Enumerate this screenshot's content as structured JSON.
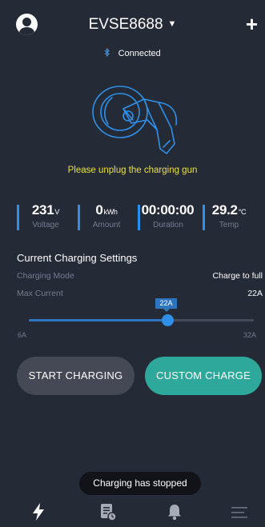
{
  "header": {
    "device_name": "EVSE8688",
    "caret": "▼",
    "add_label": "+"
  },
  "connection": {
    "icon": "bluetooth-icon",
    "status": "Connected"
  },
  "charger": {
    "image_icon": "charging-gun-icon",
    "notice": "Please unplug the charging gun"
  },
  "stats": [
    {
      "value": "231",
      "unit": "V",
      "label": "Voltage"
    },
    {
      "value": "0",
      "unit": "kWh",
      "label": "Amount"
    },
    {
      "value": "00:00:00",
      "unit": "",
      "label": "Duration"
    },
    {
      "value": "29.2",
      "unit": "°C",
      "label": "Temp"
    }
  ],
  "settings": {
    "title": "Current Charging Settings",
    "mode_label": "Charging Mode",
    "mode_value": "Charge to full",
    "max_current_label": "Max Current",
    "max_current_value": "22A",
    "slider": {
      "value_label": "22A",
      "min_label": "6A",
      "max_label": "32A",
      "min": 6,
      "max": 32,
      "value": 22
    }
  },
  "buttons": {
    "start": "START CHARGING",
    "custom": "CUSTOM CHARGE"
  },
  "toast": "Charging has stopped",
  "nav": [
    {
      "icon": "lightning-icon",
      "active": true
    },
    {
      "icon": "records-icon",
      "active": false
    },
    {
      "icon": "bell-icon",
      "active": false
    },
    {
      "icon": "menu-icon",
      "active": false
    }
  ],
  "colors": {
    "background": "#252a37",
    "accent_blue": "#2e90e8",
    "accent_teal": "#2ea89a",
    "notice_yellow": "#e8e04a",
    "muted_text": "#747b8c"
  }
}
